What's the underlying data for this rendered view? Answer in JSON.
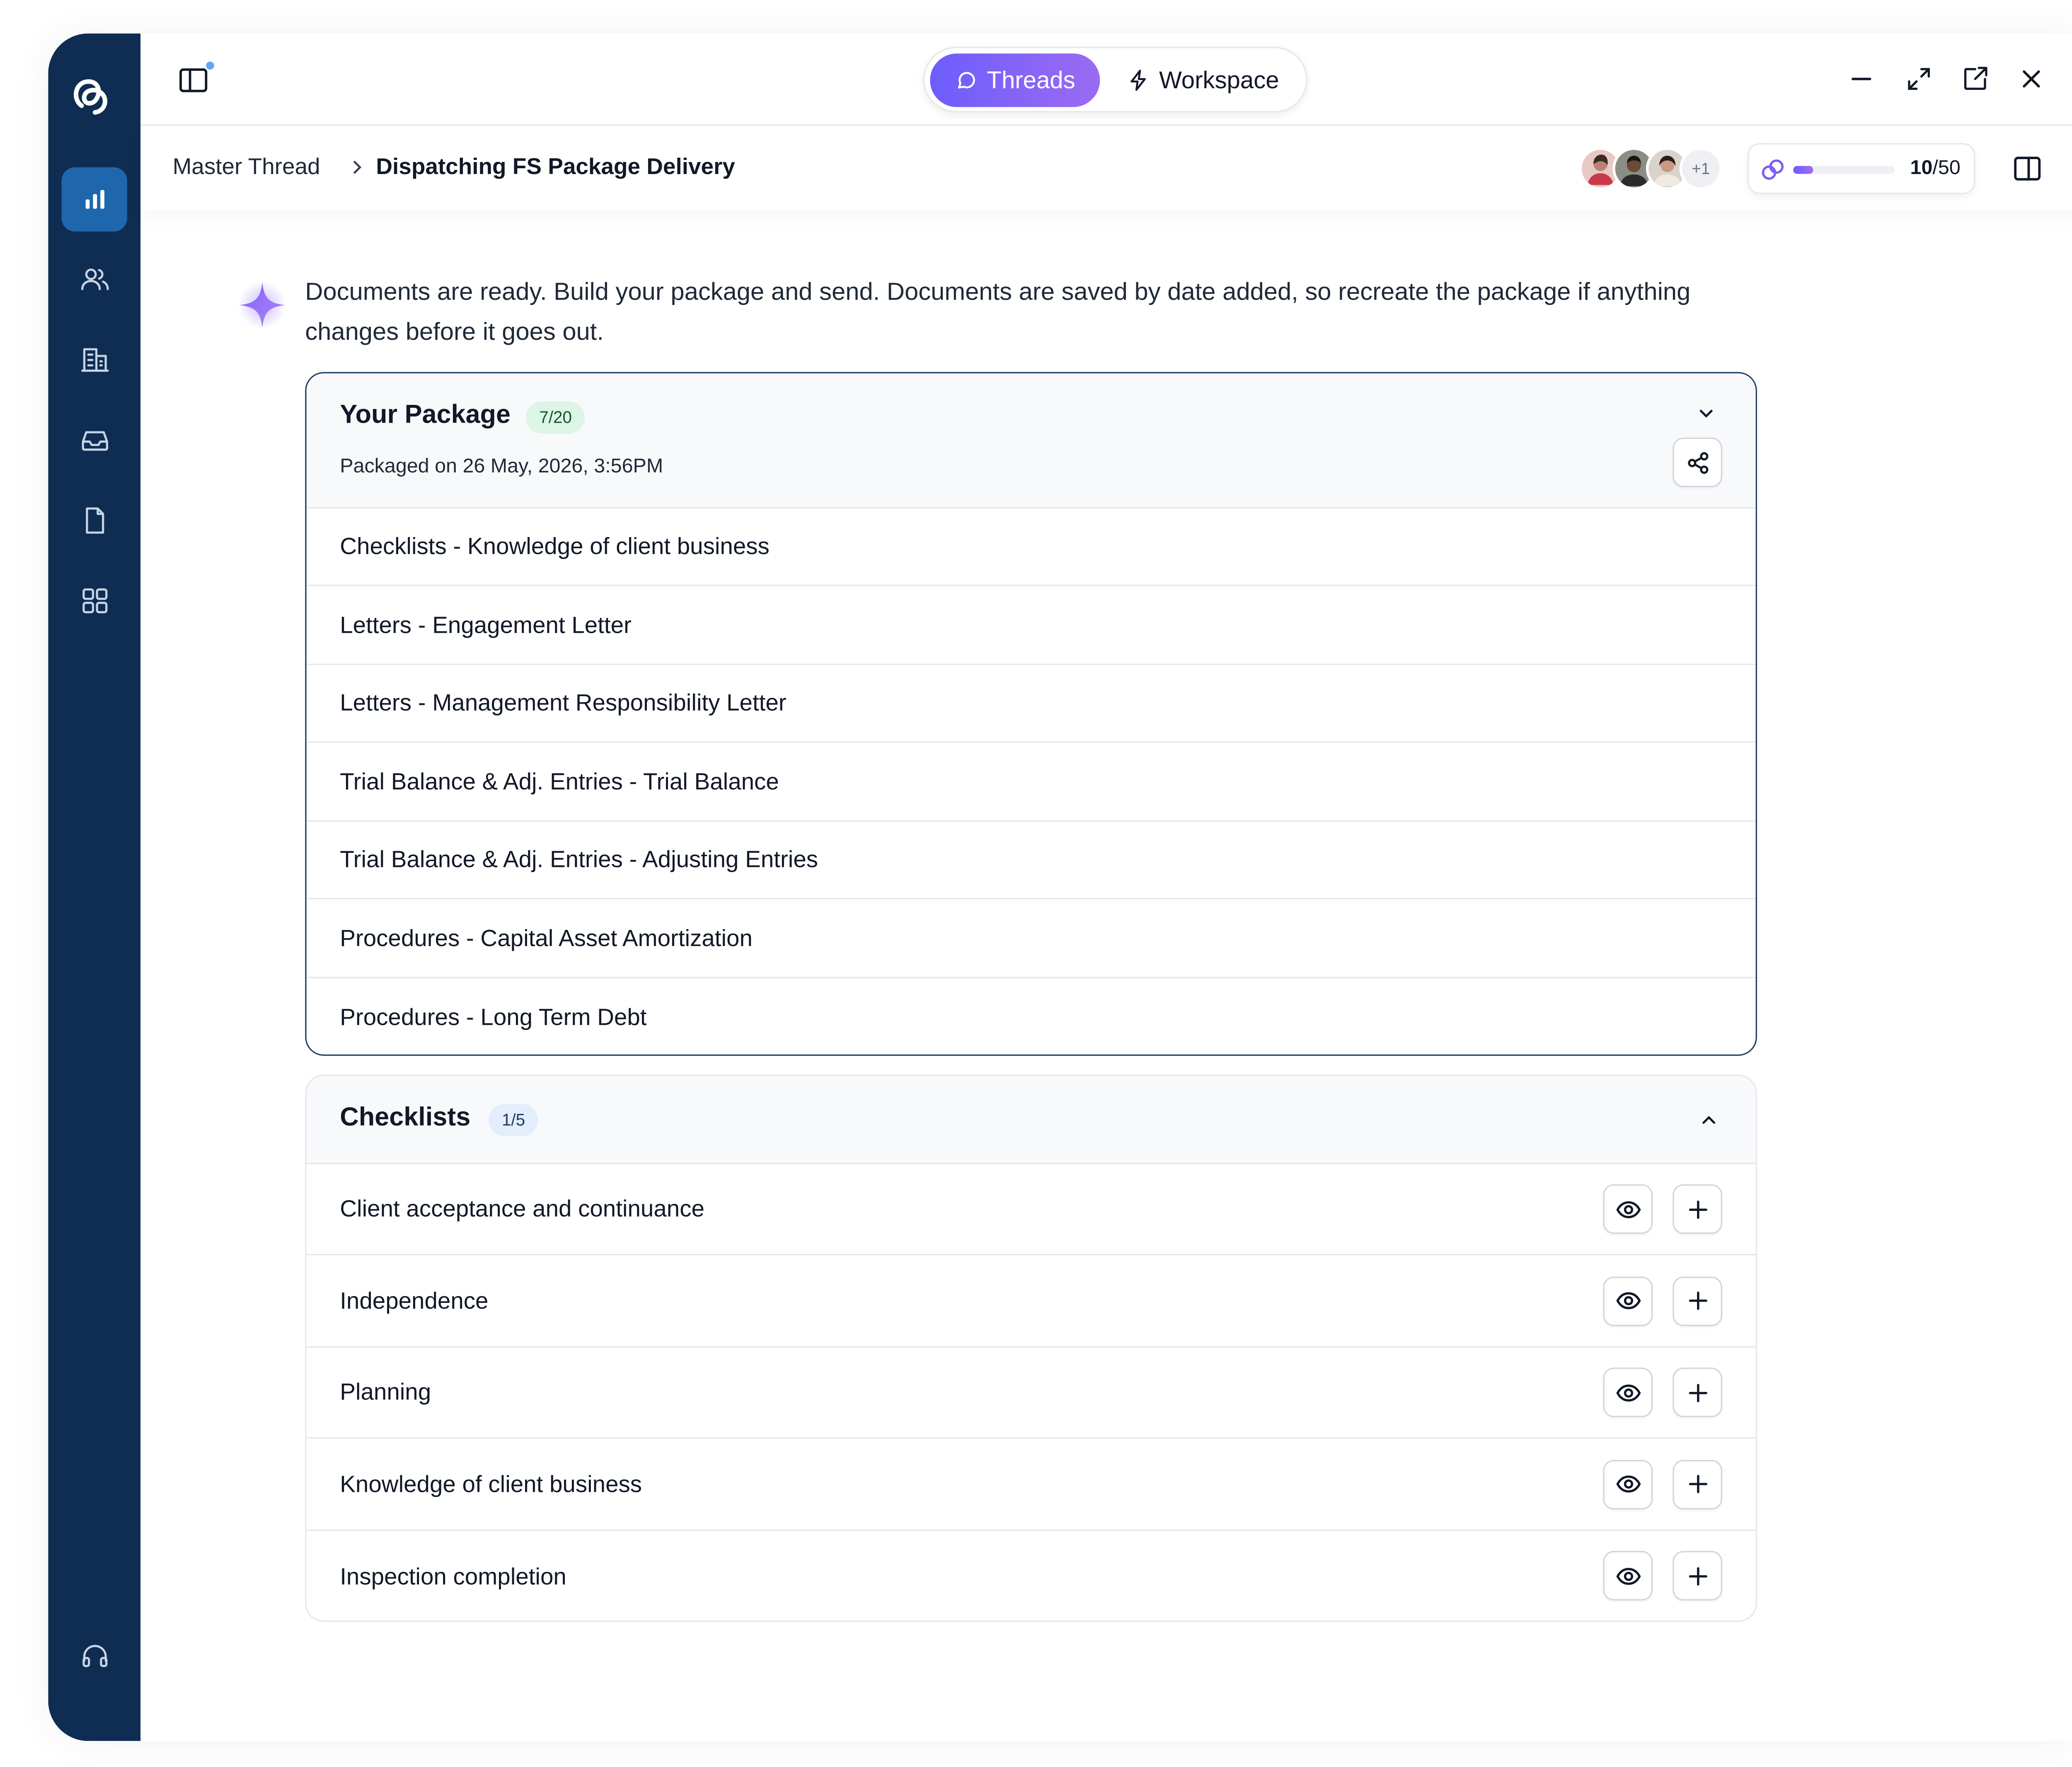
{
  "topbar": {
    "tabs": [
      {
        "label": "Threads",
        "active": true,
        "icon": "chat-bubble-icon"
      },
      {
        "label": "Workspace",
        "active": false,
        "icon": "lightning-icon"
      }
    ],
    "window_controls": [
      "minimize-icon",
      "expand-icon",
      "open-external-icon",
      "close-icon"
    ]
  },
  "sidebar": {
    "logo": "app-logo",
    "items": [
      {
        "icon": "bar-chart-icon",
        "active": true
      },
      {
        "icon": "users-icon",
        "active": false
      },
      {
        "icon": "building-icon",
        "active": false
      },
      {
        "icon": "inbox-icon",
        "active": false
      },
      {
        "icon": "document-icon",
        "active": false
      },
      {
        "icon": "grid-apps-icon",
        "active": false
      }
    ],
    "footer_icon": "headset-icon"
  },
  "breadcrumb": {
    "parent": "Master Thread",
    "current": "Dispatching FS Package Delivery"
  },
  "collaborators": {
    "more": "+1"
  },
  "usage": {
    "used": "10",
    "total": "/50",
    "fraction": 0.2
  },
  "message": {
    "text": "Documents are ready. Build your package and send. Documents are saved by date added, so recreate the package if anything changes before it goes out."
  },
  "package": {
    "title": "Your Package",
    "count": "7/20",
    "subtitle": "Packaged on 26 May, 2026, 3:56PM",
    "items": [
      "Checklists - Knowledge of client business",
      "Letters - Engagement Letter",
      "Letters - Management Responsibility Letter",
      "Trial Balance & Adj. Entries - Trial Balance",
      "Trial Balance & Adj. Entries - Adjusting Entries",
      "Procedures - Capital Asset Amortization",
      "Procedures - Long Term Debt"
    ]
  },
  "checklists": {
    "title": "Checklists",
    "count": "1/5",
    "items": [
      "Client acceptance and continuance",
      "Independence",
      "Planning",
      "Knowledge of client business",
      "Inspection completion"
    ]
  },
  "colors": {
    "sidebar": "#0f2d52",
    "active_nav": "#1f67ad",
    "accent_start": "#6d5dfc",
    "accent_end": "#9b6bf3",
    "package_border": "#1f3f66"
  }
}
